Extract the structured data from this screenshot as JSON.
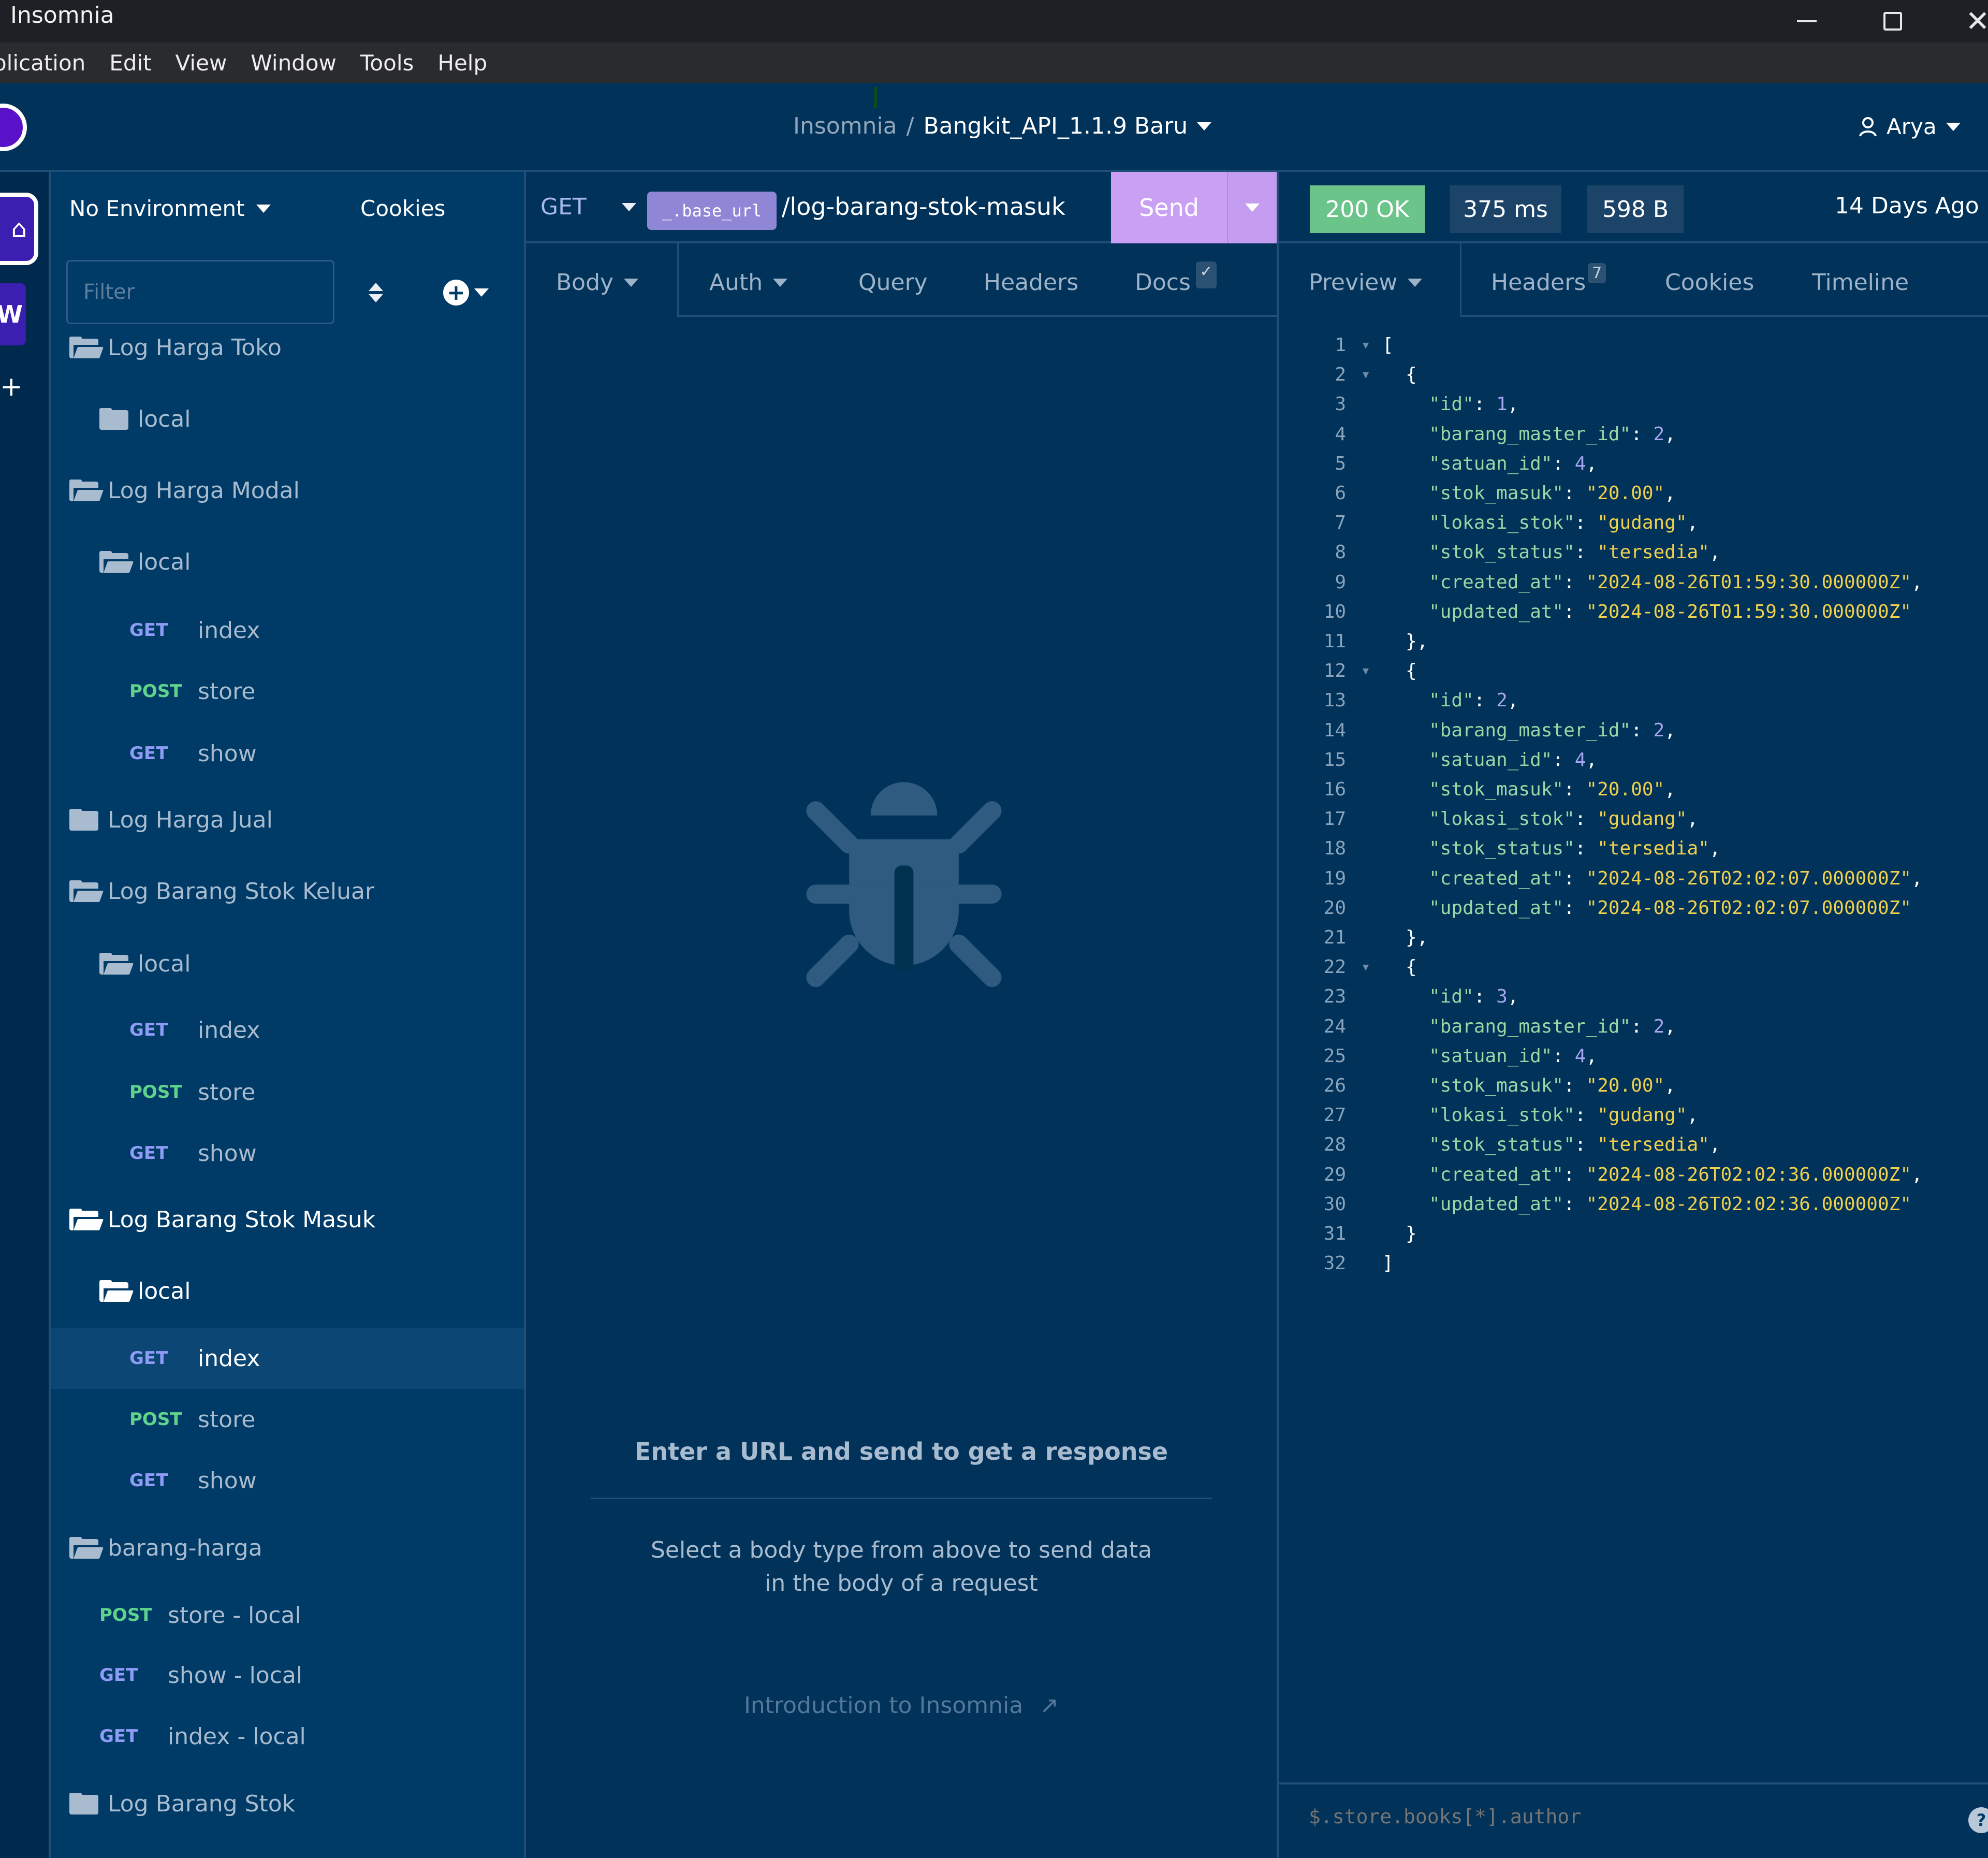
{
  "window": {
    "title": "Insomnia",
    "controls": {
      "minimize": "minimize-icon",
      "maximize": "maximize-icon",
      "close": "✕"
    }
  },
  "menu": [
    "plication",
    "Edit",
    "View",
    "Window",
    "Tools",
    "Help"
  ],
  "header": {
    "breadcrumb_root": "Insomnia",
    "breadcrumb_sep": "/",
    "project": "Bangkit_API_1.1.9 Baru",
    "user": "Arya"
  },
  "rail": {
    "home_icon": "⌂",
    "workspace_letter": "W",
    "add": "+"
  },
  "sidebar": {
    "environment": "No Environment",
    "cookies": "Cookies",
    "filter_placeholder": "Filter",
    "items": [
      {
        "type": "folder",
        "open": true,
        "label": "Log Harga Toko",
        "depth": 0
      },
      {
        "type": "folder",
        "open": false,
        "label": "local",
        "depth": 1
      },
      {
        "type": "folder",
        "open": true,
        "label": "Log Harga Modal",
        "depth": 0
      },
      {
        "type": "folder",
        "open": true,
        "label": "local",
        "depth": 1
      },
      {
        "type": "request",
        "method": "GET",
        "label": "index",
        "depth": 2
      },
      {
        "type": "request",
        "method": "POST",
        "label": "store",
        "depth": 2
      },
      {
        "type": "request",
        "method": "GET",
        "label": "show",
        "depth": 2
      },
      {
        "type": "folder",
        "open": false,
        "label": "Log Harga Jual",
        "depth": 0
      },
      {
        "type": "folder",
        "open": true,
        "label": "Log Barang Stok Keluar",
        "depth": 0
      },
      {
        "type": "folder",
        "open": true,
        "label": "local",
        "depth": 1
      },
      {
        "type": "request",
        "method": "GET",
        "label": "index",
        "depth": 2
      },
      {
        "type": "request",
        "method": "POST",
        "label": "store",
        "depth": 2
      },
      {
        "type": "request",
        "method": "GET",
        "label": "show",
        "depth": 2
      },
      {
        "type": "folder",
        "open": true,
        "label": "Log Barang Stok Masuk",
        "depth": 0,
        "bright": true
      },
      {
        "type": "folder",
        "open": true,
        "label": "local",
        "depth": 1,
        "bright": true
      },
      {
        "type": "request",
        "method": "GET",
        "label": "index",
        "depth": 2,
        "selected": true
      },
      {
        "type": "request",
        "method": "POST",
        "label": "store",
        "depth": 2
      },
      {
        "type": "request",
        "method": "GET",
        "label": "show",
        "depth": 2
      },
      {
        "type": "folder",
        "open": true,
        "label": "barang-harga",
        "depth": 0
      },
      {
        "type": "request",
        "method": "POST",
        "label": "store - local",
        "depth": 1
      },
      {
        "type": "request",
        "method": "GET",
        "label": "show - local",
        "depth": 1
      },
      {
        "type": "request",
        "method": "GET",
        "label": "index - local",
        "depth": 1
      },
      {
        "type": "folder",
        "open": false,
        "label": "Log Barang Stok",
        "depth": 0
      }
    ]
  },
  "request": {
    "method": "GET",
    "url_variable": "_.base_url",
    "url_path": "/log-barang-stok-masuk",
    "send": "Send",
    "tabs": [
      {
        "label": "Body",
        "dropdown": true
      },
      {
        "label": "Auth",
        "dropdown": true
      },
      {
        "label": "Query"
      },
      {
        "label": "Headers"
      },
      {
        "label": "Docs",
        "check": "✓"
      }
    ],
    "empty_title": "Enter a URL and send to get a response",
    "empty_desc_1": "Select a body type from above to send data",
    "empty_desc_2": "in the body of a request",
    "intro_link": "Introduction to Insomnia",
    "intro_link_icon": "↗"
  },
  "response": {
    "status": "200 OK",
    "time": "375 ms",
    "size": "598 B",
    "history": "14 Days Ago",
    "tabs": [
      {
        "label": "Preview",
        "dropdown": true
      },
      {
        "label": "Headers",
        "count": "7"
      },
      {
        "label": "Cookies"
      },
      {
        "label": "Timeline"
      }
    ],
    "filter_placeholder": "$.store.books[*].author",
    "help": "?",
    "body": [
      {
        "id": 1,
        "barang_master_id": 2,
        "satuan_id": 4,
        "stok_masuk": "20.00",
        "lokasi_stok": "gudang",
        "stok_status": "tersedia",
        "created_at": "2024-08-26T01:59:30.000000Z",
        "updated_at": "2024-08-26T01:59:30.000000Z"
      },
      {
        "id": 2,
        "barang_master_id": 2,
        "satuan_id": 4,
        "stok_masuk": "20.00",
        "lokasi_stok": "gudang",
        "stok_status": "tersedia",
        "created_at": "2024-08-26T02:02:07.000000Z",
        "updated_at": "2024-08-26T02:02:07.000000Z"
      },
      {
        "id": 3,
        "barang_master_id": 2,
        "satuan_id": 4,
        "stok_masuk": "20.00",
        "lokasi_stok": "gudang",
        "stok_status": "tersedia",
        "created_at": "2024-08-26T02:02:36.000000Z",
        "updated_at": "2024-08-26T02:02:36.000000Z"
      }
    ]
  },
  "colors": {
    "background": "#00325a",
    "sidebar": "#003a66",
    "accent_send": "#c9a0f3",
    "status_ok": "#6bc58a",
    "method_get": "#8e9cf5",
    "method_post": "#5fd38c",
    "json_key": "#9bd7a4",
    "json_string": "#f0d04c",
    "json_number": "#a8a6f0"
  }
}
